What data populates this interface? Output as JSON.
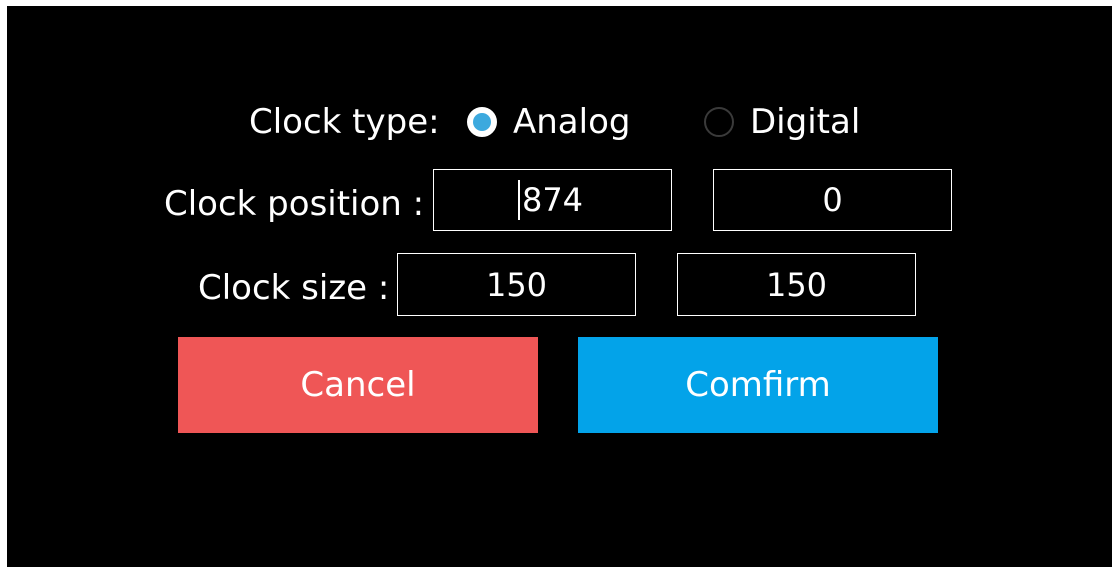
{
  "dialog": {
    "clock_type": {
      "label": "Clock type:",
      "options": [
        {
          "label": "Analog",
          "checked": true
        },
        {
          "label": "Digital",
          "checked": false
        }
      ]
    },
    "clock_position": {
      "label": "Clock position :",
      "x_value": "874",
      "y_value": "0"
    },
    "clock_size": {
      "label": "Clock size :",
      "width_value": "150",
      "height_value": "150"
    },
    "buttons": {
      "cancel_label": "Cancel",
      "confirm_label": "Comfirm"
    }
  },
  "colors": {
    "background": "#000000",
    "radio_checked": "#3ca9de",
    "cancel_button": "#ef5656",
    "confirm_button": "#03a3e9",
    "field_border": "#ffffff",
    "text": "#ffffff"
  }
}
